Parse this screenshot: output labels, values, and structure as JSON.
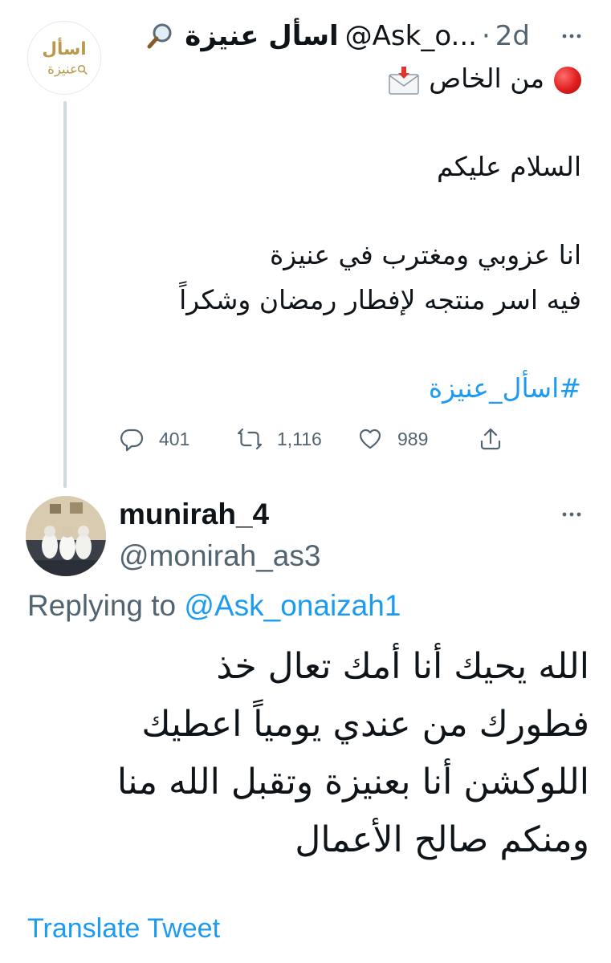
{
  "tweet": {
    "author_name": "اسأل عنيزة",
    "author_handle": "@Ask_o...",
    "separator": "·",
    "time": "2d",
    "avatar_text_top": "اسأل",
    "avatar_text_bottom": "عنيزة",
    "lines": [
      "من الخاص",
      "",
      "السلام عليكم",
      "",
      "انا عزوبي ومغترب في عنيزة",
      "فيه اسر منتجه لإفطار رمضان وشكراً",
      ""
    ],
    "hashtag": "#اسأل_عنيزة",
    "stats": {
      "replies": "401",
      "retweets": "1,116",
      "likes": "989"
    },
    "icons": [
      "magnifier-icon",
      "red-dot-icon",
      "envelope-icon",
      "more-icon"
    ]
  },
  "reply": {
    "author_name": "munirah_4",
    "author_handle": "@monirah_as3",
    "replying_prefix": "Replying to",
    "replying_to": "@Ask_onaizah1",
    "lines": [
      "الله يحيك  أنا أمك تعال خذ",
      "فطورك من عندي يومياً  اعطيك",
      "اللوكشن  أنا بعنيزة وتقبل الله منا",
      "ومنكم صالح الأعمال"
    ],
    "translate_label": "Translate Tweet"
  },
  "colors": {
    "accent": "#1d9bf0",
    "muted": "#536471",
    "text": "#0f1419",
    "thread_line": "#cfd9de",
    "logo_gold": "#b89a4a"
  }
}
